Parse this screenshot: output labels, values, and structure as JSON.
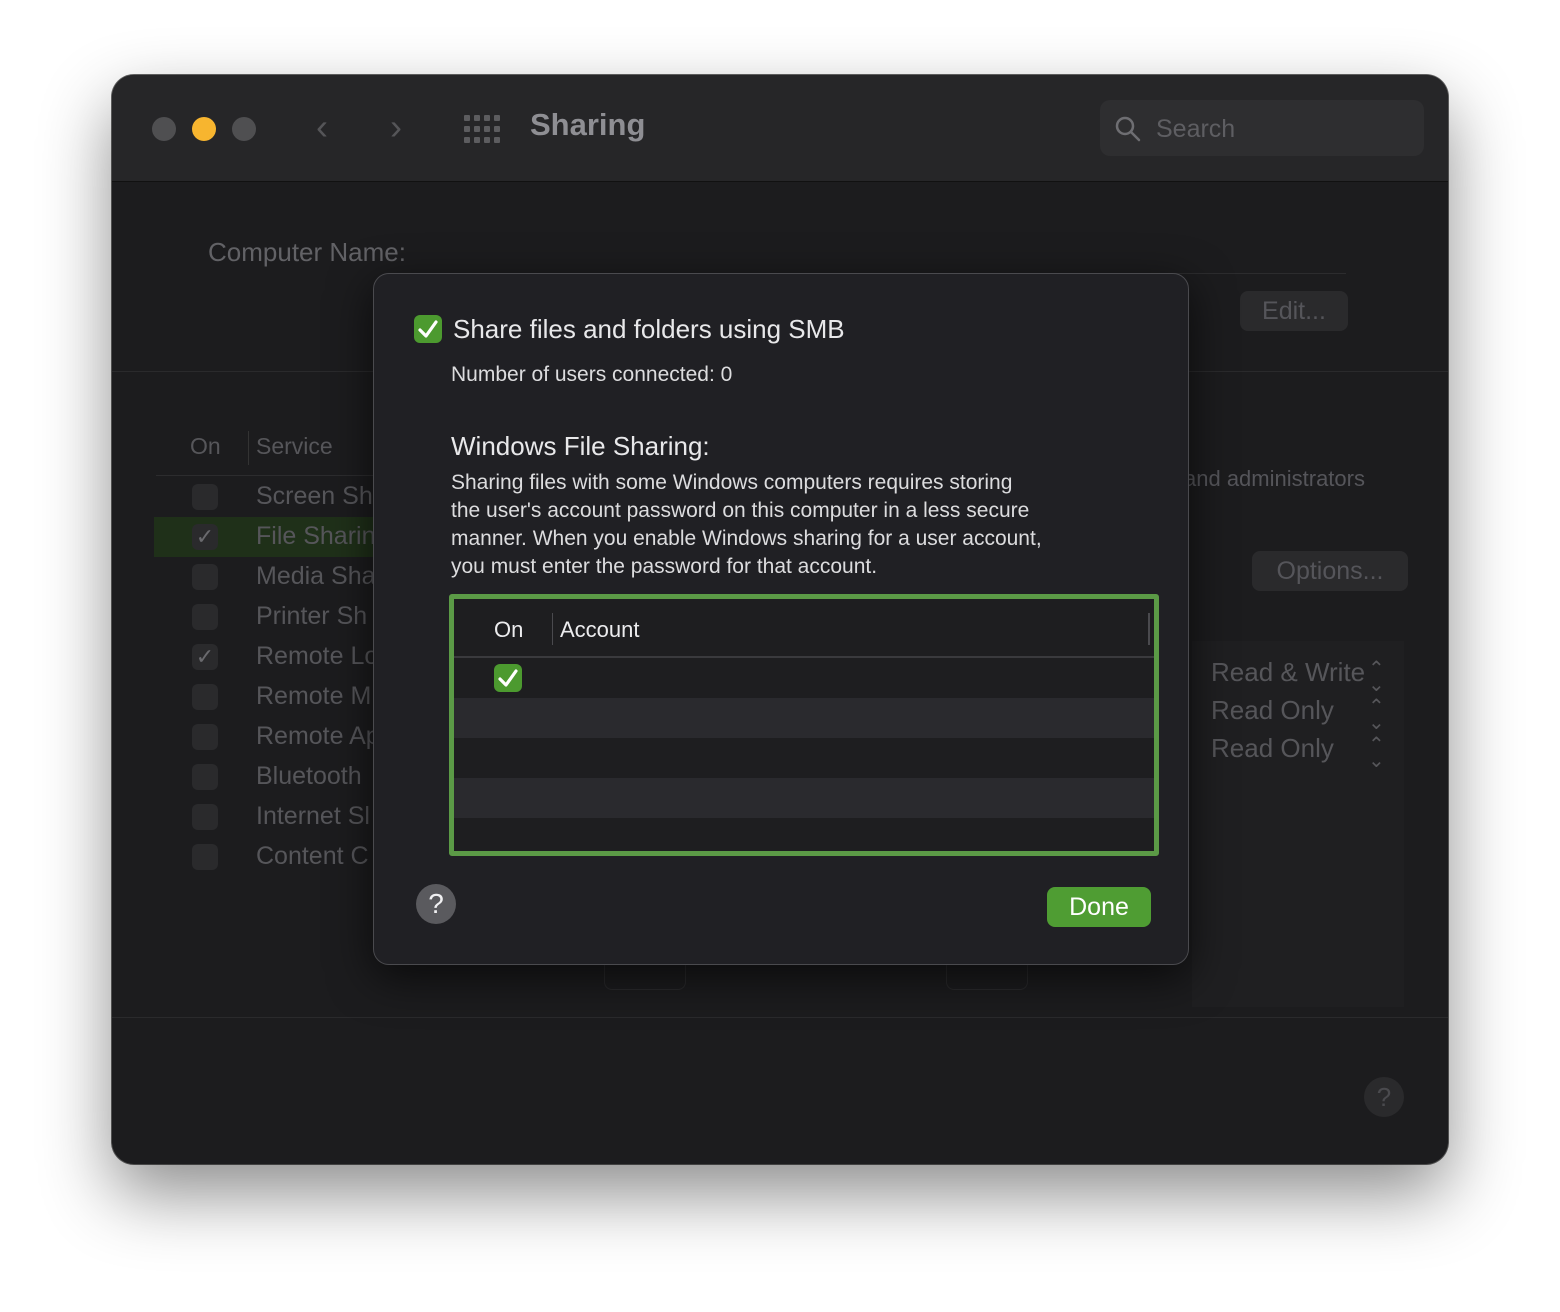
{
  "window": {
    "title": "Sharing"
  },
  "search": {
    "placeholder": "Search"
  },
  "background": {
    "computer_name_label": "Computer Name:",
    "edit_button": "Edit...",
    "list_header": {
      "on": "On",
      "service": "Service"
    },
    "services": [
      {
        "name": "Screen Sh",
        "checked": false
      },
      {
        "name": "File Sharin",
        "checked": true,
        "selected": true
      },
      {
        "name": "Media Sha",
        "checked": false
      },
      {
        "name": "Printer Sh",
        "checked": false
      },
      {
        "name": "Remote Lo",
        "checked": true
      },
      {
        "name": "Remote M",
        "checked": false
      },
      {
        "name": "Remote Ap",
        "checked": false
      },
      {
        "name": "Bluetooth",
        "checked": false
      },
      {
        "name": "Internet Sl",
        "checked": false
      },
      {
        "name": "Content C",
        "checked": false
      }
    ],
    "admin_text": "and administrators",
    "options_button": "Options...",
    "permissions": [
      "Read & Write",
      "Read Only",
      "Read Only"
    ]
  },
  "sheet": {
    "smb_checkbox_label": "Share files and folders using SMB",
    "smb_checked": true,
    "users_connected": "Number of users connected: 0",
    "windows_title": "Windows File Sharing:",
    "windows_description": "Sharing files with some Windows computers requires storing\nthe user's account password on this computer in a less secure\nmanner. When you enable Windows sharing for a user account,\nyou must enter the password for that account.",
    "table": {
      "col_on": "On",
      "col_account": "Account",
      "rows": [
        {
          "on": true,
          "account": ""
        }
      ]
    },
    "help_glyph": "?",
    "done_button": "Done"
  },
  "colors": {
    "accent_green": "#4f9d33",
    "focus_ring": "#5b9a46",
    "minimize_yellow": "#f7b52f"
  }
}
